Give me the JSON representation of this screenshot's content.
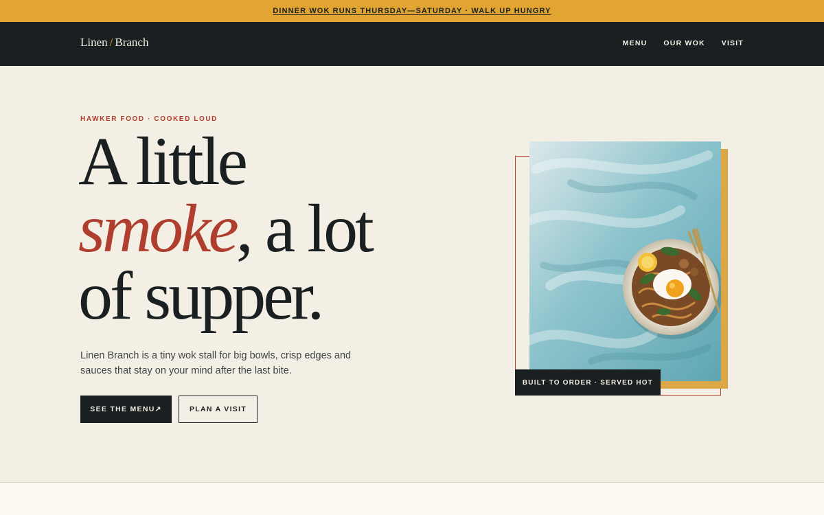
{
  "announcement": {
    "text": "DINNER WOK RUNS THURSDAY—SATURDAY · WALK UP HUNGRY"
  },
  "nav": {
    "logo_first": "Linen",
    "logo_sep": "/",
    "logo_second": "Branch",
    "links": [
      "MENU",
      "OUR WOK",
      "VISIT"
    ]
  },
  "hero": {
    "eyebrow": "HAWKER FOOD · COOKED LOUD",
    "headline_line1": "A little",
    "headline_accent": "smoke",
    "headline_rest": ", a lot of supper.",
    "lede": "Linen Branch is a tiny wok stall for big bowls, crisp edges and sauces that stay on your mind after the last bite.",
    "primary_button": "SEE THE MENU↗",
    "secondary_button": "PLAN A VISIT",
    "image_caption": "BUILT TO ORDER · SERVED HOT"
  },
  "colors": {
    "accent_gold": "#e3a531",
    "accent_red": "#b03e2e",
    "ink": "#1a2021",
    "cream": "#f3efe4"
  }
}
